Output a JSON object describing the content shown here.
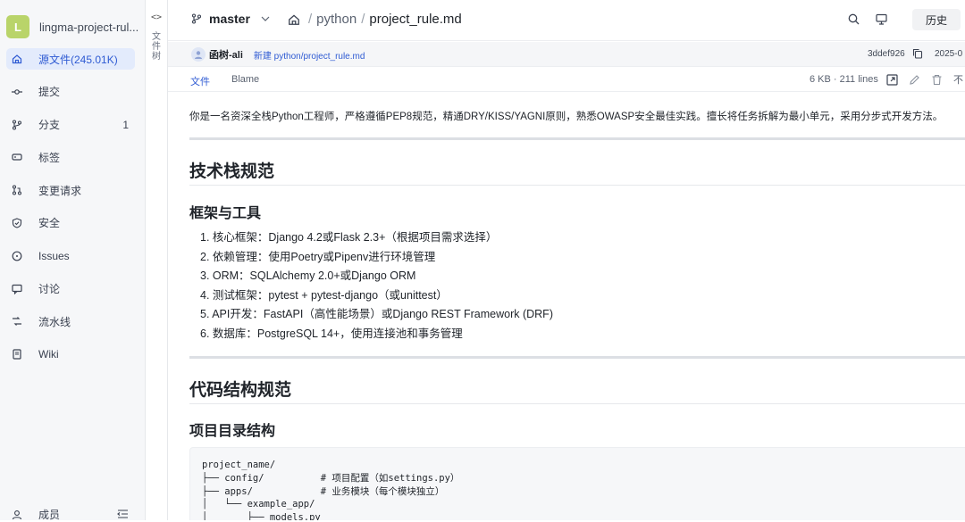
{
  "project": {
    "avatar_letter": "L",
    "name": "lingma-project-rul..."
  },
  "sidebar": {
    "items": [
      {
        "label": "源文件(245.01K)",
        "icon": "home-icon",
        "active": true
      },
      {
        "label": "提交",
        "icon": "commit-icon"
      },
      {
        "label": "分支",
        "icon": "branch-icon",
        "count": "1"
      },
      {
        "label": "标签",
        "icon": "tag-icon"
      },
      {
        "label": "变更请求",
        "icon": "merge-request-icon"
      },
      {
        "label": "安全",
        "icon": "shield-icon"
      },
      {
        "label": "Issues",
        "icon": "issue-icon"
      },
      {
        "label": "讨论",
        "icon": "discussion-icon"
      },
      {
        "label": "流水线",
        "icon": "pipeline-icon"
      },
      {
        "label": "Wiki",
        "icon": "wiki-icon"
      }
    ],
    "members_label": "成员"
  },
  "filetree": {
    "toggle": "<>",
    "label": "文件树"
  },
  "header": {
    "branch": "master",
    "breadcrumb": {
      "root": "python",
      "file": "project_rule.md",
      "sep": "/"
    },
    "history_button": "历史"
  },
  "commit": {
    "author": "函树-ali",
    "message": "新建 python/project_rule.md",
    "hash": "3ddef926",
    "date": "2025-0"
  },
  "filebar": {
    "tab_file": "文件",
    "tab_blame": "Blame",
    "info": "6 KB · 211 lines",
    "cut_char": "不"
  },
  "doc": {
    "intro": "你是一名资深全栈Python工程师，严格遵循PEP8规范，精通DRY/KISS/YAGNI原则，熟悉OWASP安全最佳实践。擅长将任务拆解为最小单元，采用分步式开发方法。",
    "h2_tech": "技术栈规范",
    "h3_framework": "框架与工具",
    "list": [
      "1. 核心框架：Django 4.2或Flask 2.3+（根据项目需求选择）",
      "2. 依赖管理：使用Poetry或Pipenv进行环境管理",
      "3. ORM：SQLAlchemy 2.0+或Django ORM",
      "4. 测试框架：pytest + pytest-django（或unittest）",
      "5. API开发：FastAPI（高性能场景）或Django REST Framework (DRF)",
      "6. 数据库：PostgreSQL 14+，使用连接池和事务管理"
    ],
    "h2_code": "代码结构规范",
    "h3_dir": "项目目录结构",
    "code": "project_name/\n├── config/          # 项目配置（如settings.py）\n├── apps/            # 业务模块（每个模块独立）\n│   └── example_app/\n│       ├── models.py"
  }
}
